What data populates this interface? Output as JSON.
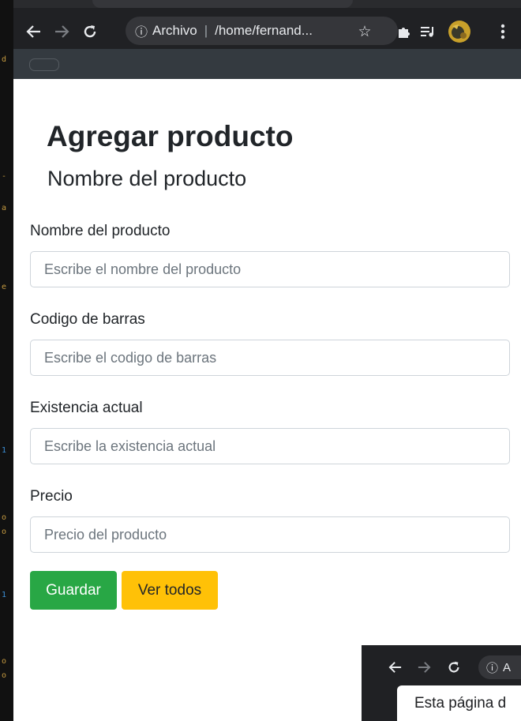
{
  "browser": {
    "back_icon": "arrow-left-icon",
    "forward_icon": "arrow-right-icon",
    "reload_icon": "reload-icon",
    "info_icon": "info-icon",
    "scheme_label": "Archivo",
    "url": "/home/fernand...",
    "bookmark_icon": "star-icon",
    "extensions_icon": "puzzle-icon",
    "media_icon": "playlist-icon",
    "profile_icon": "avatar",
    "menu_icon": "kebab-menu-icon"
  },
  "page": {
    "title": "Agregar producto",
    "subtitle": "Nombre del producto"
  },
  "form": {
    "fields": [
      {
        "label": "Nombre del producto",
        "placeholder": "Escribe el nombre del producto",
        "value": ""
      },
      {
        "label": "Codigo de barras",
        "placeholder": "Escribe el codigo de barras",
        "value": ""
      },
      {
        "label": "Existencia actual",
        "placeholder": "Escribe la existencia actual",
        "value": ""
      },
      {
        "label": "Precio",
        "placeholder": "Precio del producto",
        "value": ""
      }
    ],
    "save_label": "Guardar",
    "view_all_label": "Ver todos"
  },
  "second_window": {
    "info_label": "A",
    "message": "Esta página d"
  },
  "colors": {
    "success": "#28a745",
    "warning": "#ffc107",
    "navbar": "#343a40",
    "chrome": "#202124"
  }
}
